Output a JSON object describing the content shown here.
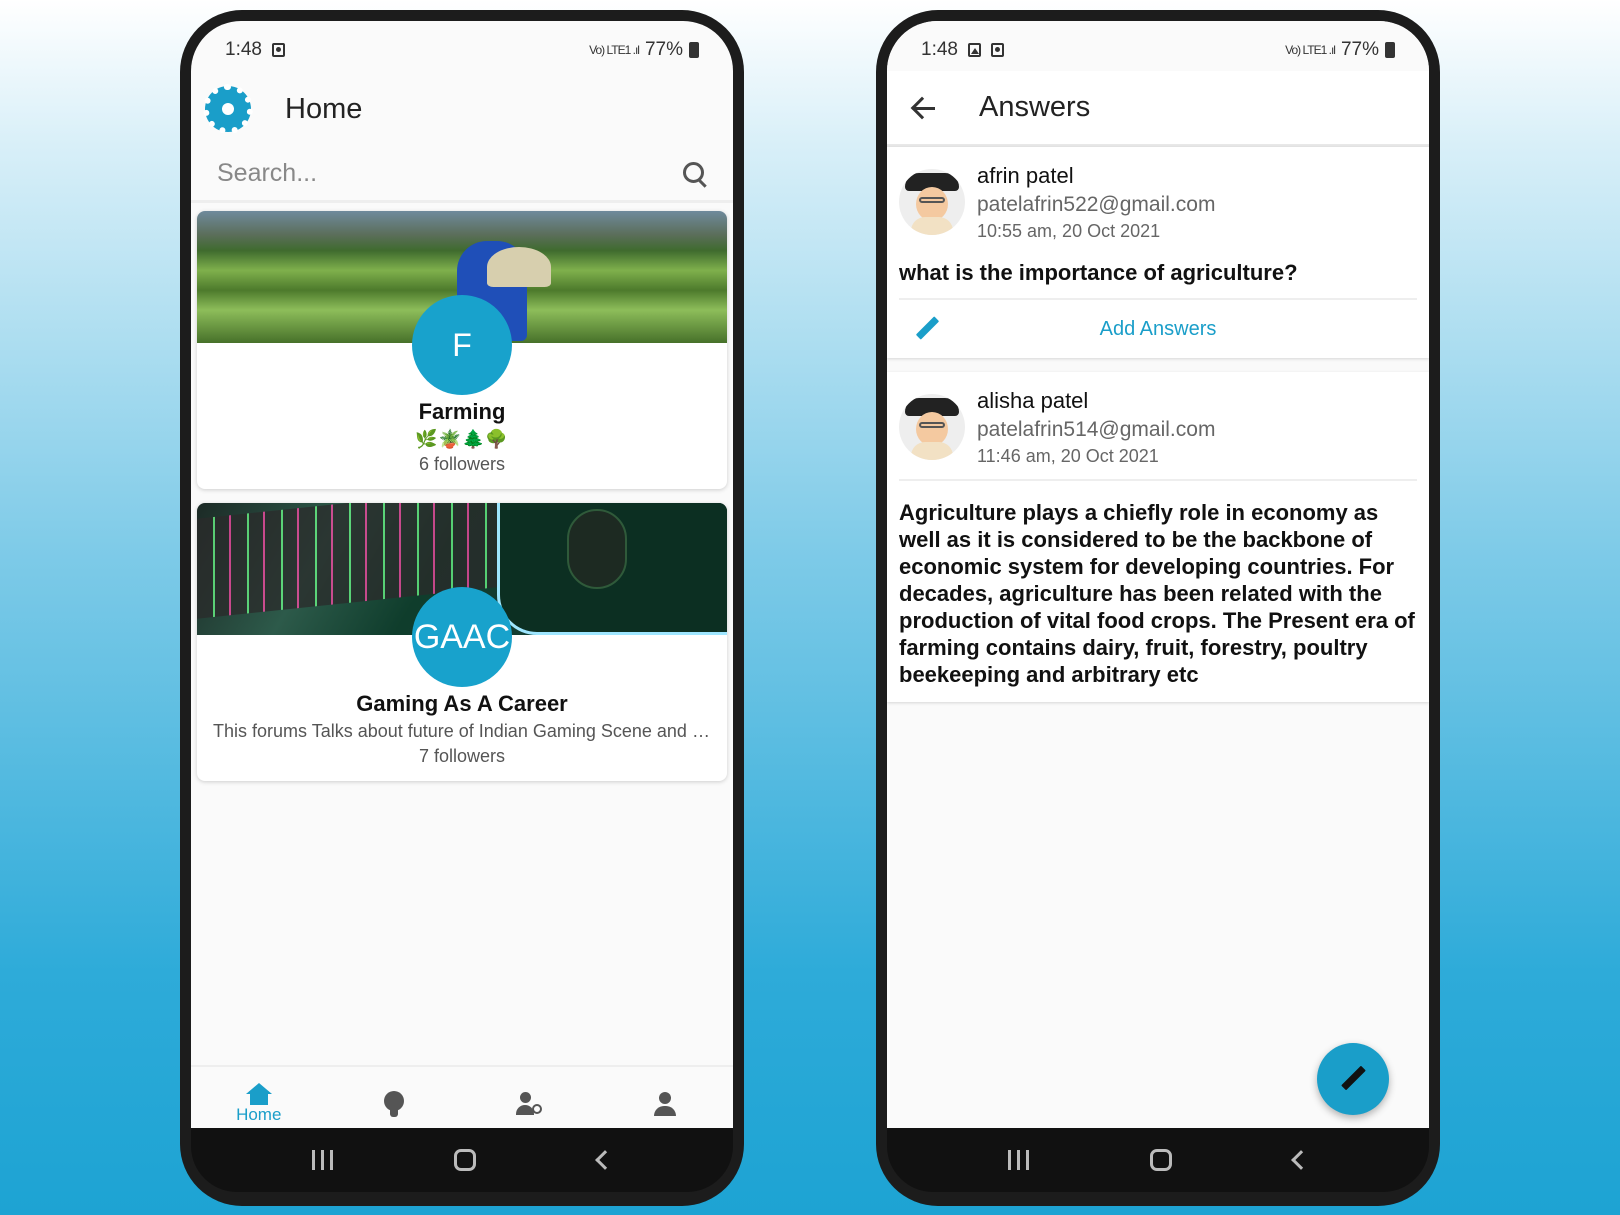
{
  "left_phone": {
    "status": {
      "time": "1:48",
      "network": "Vo) LTE1 .ıl",
      "battery": "77%"
    },
    "appbar": {
      "title": "Home",
      "logo_icon": "app-logo-icon"
    },
    "search": {
      "placeholder": "Search..."
    },
    "forums": [
      {
        "initial": "F",
        "title": "Farming",
        "description": "🌿🪴🌲🌳",
        "followers": "6 followers"
      },
      {
        "initial": "GAAC",
        "title": "Gaming As A Career",
        "description": "This forums Talks about future of Indian Gaming Scene and more",
        "followers": "7 followers"
      }
    ],
    "bottom_nav": [
      {
        "label": "Home",
        "icon": "home-icon",
        "active": true
      },
      {
        "label": "",
        "icon": "lightbulb-icon",
        "active": false
      },
      {
        "label": "",
        "icon": "people-search-icon",
        "active": false
      },
      {
        "label": "",
        "icon": "person-icon",
        "active": false
      }
    ]
  },
  "right_phone": {
    "status": {
      "time": "1:48",
      "network": "Vo) LTE1 .ıl",
      "battery": "77%"
    },
    "appbar": {
      "title": "Answers"
    },
    "question": {
      "user": "afrin patel",
      "email": "patelafrin522@gmail.com",
      "time": "10:55 am, 20 Oct 2021",
      "text": "what is the importance of agriculture?",
      "add_label": "Add Answers"
    },
    "answers": [
      {
        "user": "alisha patel",
        "email": "patelafrin514@gmail.com",
        "time": "11:46 am, 20 Oct 2021",
        "text": "Agriculture plays a chiefly role in economy as well as it is considered to be the backbone of economic system for developing countries. For decades, agriculture has been related with the production of vital food crops. The Present era of farming contains dairy, fruit, forestry, poultry beekeeping and arbitrary etc"
      }
    ]
  },
  "colors": {
    "accent": "#1a9ec9",
    "text": "#111111",
    "muted": "#666666"
  }
}
